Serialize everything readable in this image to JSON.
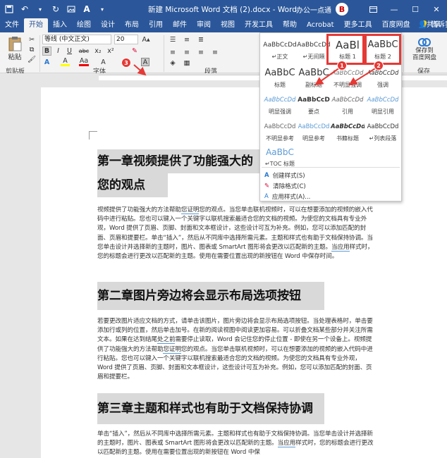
{
  "titlebar": {
    "title": "新建 Microsoft Word 文档 (2).docx  -  Word",
    "user": "办公一点通",
    "avatar_letter": "B"
  },
  "tabs": [
    "文件",
    "开始",
    "插入",
    "绘图",
    "设计",
    "布局",
    "引用",
    "邮件",
    "审阅",
    "视图",
    "开发工具",
    "帮助",
    "Acrobat",
    "更多工具",
    "百度网盘"
  ],
  "tell_me": "告诉我",
  "share": "共享",
  "ribbon": {
    "paste": "粘贴",
    "clipboard_label": "剪贴板",
    "font_name": "等线 (中文正文)",
    "font_size": "20",
    "font_label": "字体",
    "paragraph_label": "段落",
    "save_label": "保存",
    "save_baidu": "保存到\n百度网盘",
    "font_buttons": [
      "B",
      "I",
      "U",
      "abc",
      "x₂",
      "x²"
    ],
    "font_row3": [
      "A",
      "A",
      "Aa",
      "A",
      "A",
      "A"
    ]
  },
  "gallery": {
    "rows": [
      [
        {
          "preview": "AaBbCcDd",
          "name": "↵正文"
        },
        {
          "preview": "AaBbCcDd",
          "name": "↵无间隔"
        },
        {
          "preview": "AaBl",
          "name": "标题 1"
        },
        {
          "preview": "AaBbC",
          "name": "标题 2"
        }
      ],
      [
        {
          "preview": "AaBbC",
          "name": "标题"
        },
        {
          "preview": "AaBbC",
          "name": "副标题"
        },
        {
          "preview": "AaBbCcDd",
          "name": "不明显强调"
        },
        {
          "preview": "AaBbCcDd",
          "name": "强调"
        }
      ],
      [
        {
          "preview": "AaBbCcDd",
          "name": "明显强调"
        },
        {
          "preview": "AaBbCcD",
          "name": "要点"
        },
        {
          "preview": "AaBbCcDd",
          "name": "引用"
        },
        {
          "preview": "AaBbCcDd",
          "name": "明显引用"
        }
      ],
      [
        {
          "preview": "AaBbCcDd",
          "name": "不明显参考"
        },
        {
          "preview": "AaBbCcDd",
          "name": "明显参考"
        },
        {
          "preview": "AaBbCcDd",
          "name": "书籍标题"
        },
        {
          "preview": "AaBbCcDd",
          "name": "↵列表段落"
        }
      ],
      [
        {
          "preview": "AaBbC",
          "name": "↵TOC 标题"
        }
      ]
    ],
    "commands": [
      "创建样式(S)",
      "清除格式(C)",
      "应用样式(A)..."
    ]
  },
  "annotations": [
    "1",
    "2",
    "3"
  ],
  "document": {
    "h1_line1": "第一章视频提供了功能强大的",
    "h1_line2": "您的观点",
    "p1": [
      "视频提供了功能强大的方法帮助",
      "您证明",
      "您的观点。当您单击联机视频时，可以在想要添加的视频的嵌入代码中进行粘贴。您也可以键入一个关键字以联机搜索最适合您的文档的视频。为使您的文档具有专业外观，Word 提供了页眉、页脚、封面和文本框设计，这些设计可互为补充。例如，您可以添加匹配的封面、页眉和提要栏。单击“插入”，然后从不同库中选择所需元素。主题和样式也有助于文档保持协调。当您单击设计并选择新的主题时，图片、图表或 SmartArt 图形将会更改以匹配新的主题。",
      "当应用",
      "样式时，您的标题会进行更改以匹配新的主题。使用在需要位置出现的新按钮在 Word 中保存时间。"
    ],
    "h2": "第二章图片旁边将会显示布局选项按钮",
    "p2": [
      "若要更改图片适应文档的方式，请单击该图片，图片旁边将会显示布局选项按钮。当处理表格时，单击要添加行或列的位置，然后单击加号。在新的阅读视图中阅读更加容易。可以折叠文档某些部分并关注所需文本。如果在达到结尾",
      "处之前",
      "需要停止读取，Word 会记住您的停止位置 - 即使在另一个设备上。视频提供了功能强大的方法帮助",
      "您证明",
      "您的观点。当您单击联机视频时，可以在想要添加的视频的嵌入代码中进行粘贴。您也可以键入一个关键字以联机搜索最适合您的文档的视频。为使您的文档具有专业外观，Word 提供了页眉、页脚、封面和文本框设计，这些设计可互为补充。例如，您可以添加匹配的封面、页眉和提要栏。"
    ],
    "h3": "第三章主题和样式也有助于文档保持协调",
    "p3": [
      "单击“插入”，然后从不同库中选择所需元素。主题和样式也有助于文档保持协调。当您单击设计并选择新的主题时，图片、图表或 SmartArt 图形将会更改以匹配新的主题。",
      "当应用",
      "样式时，您的标题会进行更改以匹配新的主题。使用在需要位置出现的新按钮在 Word 中保"
    ]
  },
  "colors": {
    "title_bar": "#2b579a",
    "annotation": "#e53935",
    "heading_bg": "#d9d9d9",
    "link_style_blue": "#5b9bd5"
  }
}
